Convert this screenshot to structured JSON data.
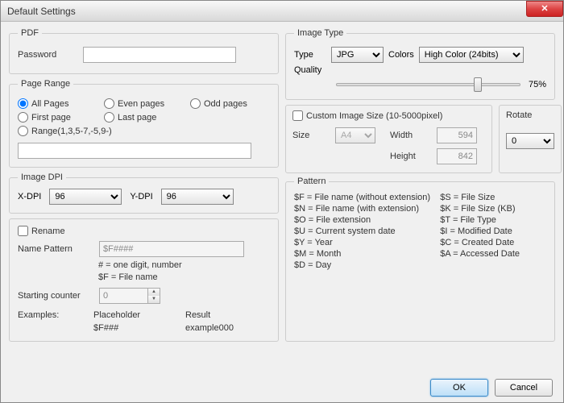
{
  "title": "Default Settings",
  "pdf": {
    "legend": "PDF",
    "password_label": "Password",
    "password_value": ""
  },
  "page_range": {
    "legend": "Page Range",
    "options": {
      "all": "All Pages",
      "even": "Even pages",
      "odd": "Odd pages",
      "first": "First page",
      "last": "Last page",
      "range": "Range(1,3,5-7,-5,9-)"
    },
    "range_value": ""
  },
  "image_dpi": {
    "legend": "Image DPI",
    "xdpi_label": "X-DPI",
    "xdpi_value": "96",
    "ydpi_label": "Y-DPI",
    "ydpi_value": "96"
  },
  "rename": {
    "checkbox_label": "Rename",
    "name_pattern_label": "Name Pattern",
    "name_pattern_value": "$F####",
    "hint1": "# = one digit, number",
    "hint2": "$F = File name",
    "starting_counter_label": "Starting counter",
    "starting_counter_value": "0",
    "examples_label": "Examples:",
    "placeholder_header": "Placeholder",
    "result_header": "Result",
    "example_placeholder": "$F###",
    "example_result": "example000"
  },
  "image_type": {
    "legend": "Image Type",
    "type_label": "Type",
    "type_value": "JPG",
    "colors_label": "Colors",
    "colors_value": "High Color (24bits)",
    "quality_label": "Quality",
    "quality_value": "75%"
  },
  "custom_size": {
    "checkbox_label": "Custom Image Size (10-5000pixel)",
    "size_label": "Size",
    "size_value": "A4",
    "width_label": "Width",
    "width_value": "594",
    "height_label": "Height",
    "height_value": "842"
  },
  "rotate": {
    "legend": "Rotate",
    "value": "0"
  },
  "pattern": {
    "legend": "Pattern",
    "left": [
      "$F = File name (without extension)",
      "$N = File name (with extension)",
      "$O = File extension",
      "$U = Current system date",
      "$Y = Year",
      "$M = Month",
      "$D = Day"
    ],
    "right": [
      "$S = File Size",
      "$K = File Size (KB)",
      "$T = File Type",
      "$I = Modified Date",
      "$C = Created Date",
      "$A = Accessed Date"
    ]
  },
  "buttons": {
    "ok": "OK",
    "cancel": "Cancel"
  }
}
